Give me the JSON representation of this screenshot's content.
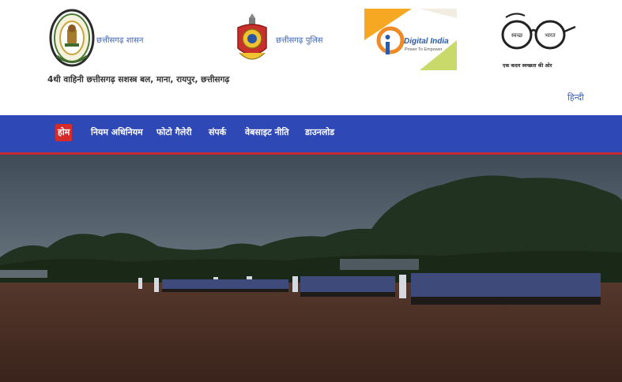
{
  "header": {
    "cg_government_label": "छत्तीसगढ़ शासन",
    "cg_police_label": "छत्तीसगढ़ पुलिस",
    "unit_name": "4थी वाहिनी छत्तीसगढ़ सशस्त्र बल, माना, रायपुर, छत्तीसगढ़",
    "digital_india": {
      "title": "Digital India",
      "tagline": "Power To Empower"
    },
    "swachh_bharat": {
      "word_left": "स्वच्छ",
      "word_right": "भारत",
      "tagline": "एक कदम स्वच्छता की ओर"
    },
    "language_link": "हिन्दी"
  },
  "nav": {
    "items": [
      {
        "label": "होम",
        "active": true
      },
      {
        "label": "नियम अधिनियम",
        "active": false
      },
      {
        "label": "फोटो गैलेरी",
        "active": false
      },
      {
        "label": "संपर्क",
        "active": false
      },
      {
        "label": "वेबसाइट नीति",
        "active": false
      },
      {
        "label": "डाउनलोड",
        "active": false
      }
    ]
  },
  "colors": {
    "nav_background": "#2e48b5",
    "nav_underline": "#c42b34",
    "active_item": "#d62b2b",
    "link_blue": "#3d64b5"
  },
  "hero": {
    "description_icon": "parade-ground-photo"
  }
}
